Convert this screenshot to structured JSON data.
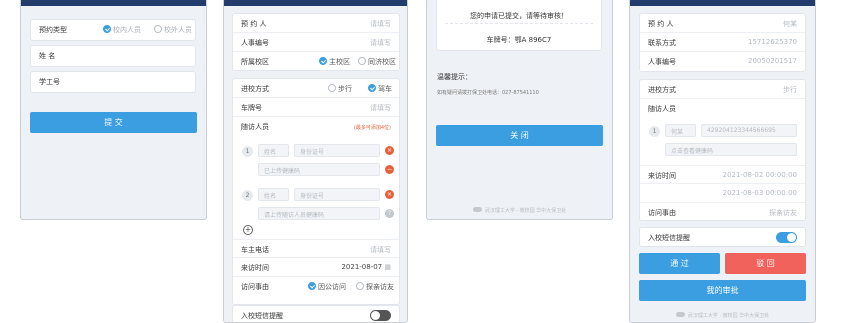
{
  "screen1": {
    "appointment_type_label": "预约类型",
    "appointment_options": [
      "校内人员",
      "校外人员"
    ],
    "name_label": "姓 名",
    "staff_id_label": "学工号",
    "submit_label": "提 交"
  },
  "screen2": {
    "visitor_label": "预 约 人",
    "visitor_ph": "请填写",
    "person_id_label": "人事编号",
    "person_id_ph": "请填写",
    "campus_label": "所属校区",
    "campus_options": [
      "主校区",
      "同济校区"
    ],
    "travel_label": "进校方式",
    "travel_options": [
      "步行",
      "驾车"
    ],
    "plate_label": "车牌号",
    "plate_ph": "请填写",
    "companions_label": "随访人员",
    "companions_hint": "(最多可添加4位)",
    "c1_num": "1",
    "c1_name_ph": "姓名",
    "c1_id_ph": "身份证号",
    "c1_plate_ph": "已上传健康码",
    "c2_num": "2",
    "c2_name_ph": "姓名",
    "c2_id_ph": "身份证号",
    "c2_plate_ph": "请上传随访人员健康码",
    "add_symbol": "+",
    "owner_phone_label": "车主电话",
    "owner_phone_ph": "请填写",
    "visit_time_label": "来访时间",
    "visit_time_value": "2021-08-07",
    "reason_label": "访问事由",
    "reason_options": [
      "因公访问",
      "探亲访友"
    ],
    "sms_label": "入校短信提醒"
  },
  "screen3": {
    "message": "您的申请已提交，请等待审核！",
    "plate_text": "车牌号：鄂A 896C7",
    "tip_title": "温馨提示：",
    "tip_text": "如有疑问请拨打保卫处电话：027-87541110",
    "close_label": "关 闭",
    "footer": "武汉理工大学 · 微校园 华中大保卫处"
  },
  "screen4": {
    "visitor_label": "预 约 人",
    "visitor_value": "何某",
    "contact_label": "联系方式",
    "contact_value": "15712625370",
    "person_id_label": "人事编号",
    "person_id_value": "20050201517",
    "travel_label": "进校方式",
    "travel_value": "步行",
    "companions_label": "随访人员",
    "c1_num": "1",
    "c1_name": "何某",
    "c1_id": "429204123344566695",
    "c1_code": "点击查看健康码",
    "visit_time_label": "来访时间",
    "visit_time_1": "2021-08-02 00:00:00",
    "visit_time_2": "2021-08-03 00:00:00",
    "reason_label": "访问事由",
    "reason_value": "探亲访友",
    "sms_label": "入校短信提醒",
    "pass_label": "通 过",
    "reject_label": "驳 回",
    "my_review_label": "我的审批",
    "footer": "武汉理工大学 · 微校园 华中大保卫处"
  },
  "colors": {
    "primary": "#3a9ee0",
    "reject": "#f0625b",
    "header": "#223d6b",
    "warning": "#e7603c"
  }
}
